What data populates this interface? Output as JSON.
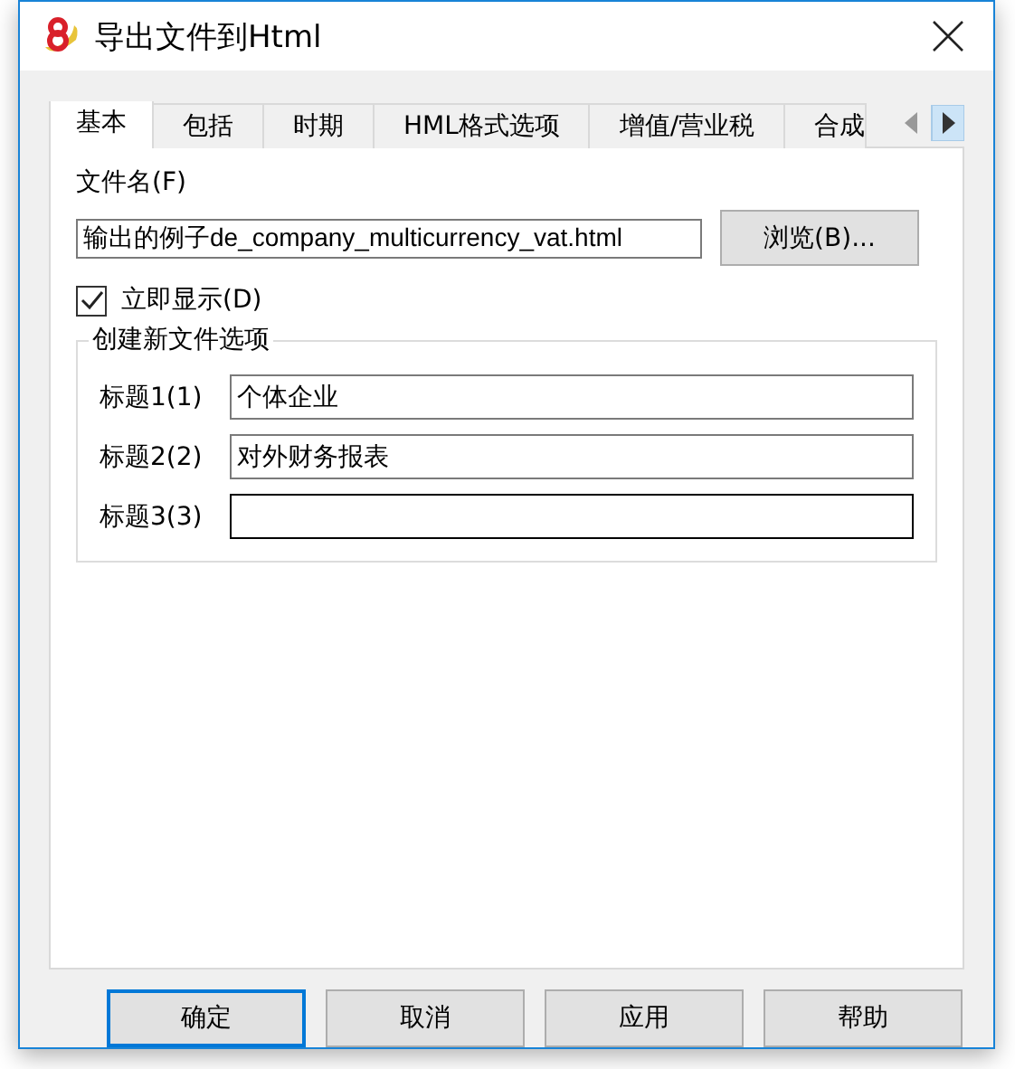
{
  "window": {
    "title": "导出文件到Html"
  },
  "tabs": [
    {
      "label": "基本",
      "selected": true
    },
    {
      "label": "包括",
      "selected": false
    },
    {
      "label": "时期",
      "selected": false
    },
    {
      "label": "HML格式选项",
      "selected": false
    },
    {
      "label": "增值/营业税",
      "selected": false
    },
    {
      "label": "合成",
      "selected": false
    }
  ],
  "file": {
    "label": "文件名(F)",
    "value": "输出的例子de_company_multicurrency_vat.html",
    "browse": "浏览(B)..."
  },
  "show_now": {
    "label": "立即显示(D)",
    "checked": true
  },
  "group": {
    "title": "创建新文件选项",
    "fields": [
      {
        "label": "标题1(1)",
        "value": "个体企业",
        "focused": false
      },
      {
        "label": "标题2(2)",
        "value": "对外财务报表",
        "focused": false
      },
      {
        "label": "标题3(3)",
        "focused": true
      }
    ]
  },
  "buttons": [
    {
      "label": "确定",
      "default": true
    },
    {
      "label": "取消",
      "default": false
    },
    {
      "label": "应用",
      "default": false
    },
    {
      "label": "帮助",
      "default": false
    }
  ]
}
